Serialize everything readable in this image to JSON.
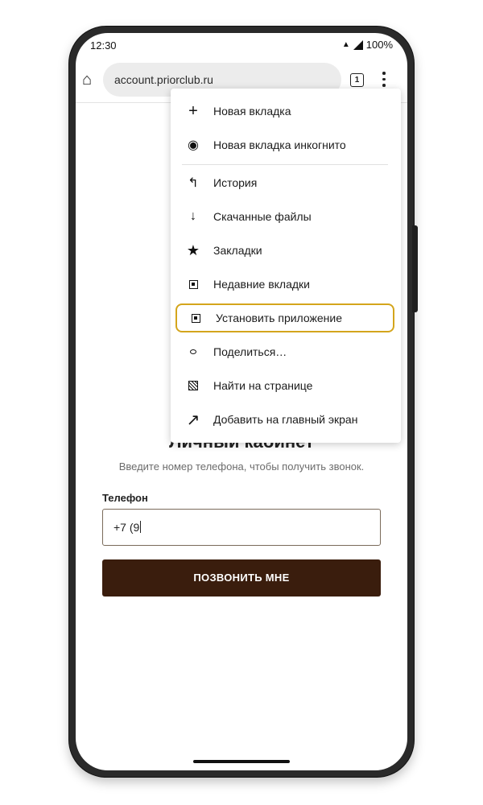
{
  "status_bar": {
    "time": "12:30",
    "battery": "100%"
  },
  "browser": {
    "url": "account.priorclub.ru",
    "tab_count": "1"
  },
  "menu": {
    "items": [
      {
        "label": "Новая вкладка",
        "icon": "plus-icon"
      },
      {
        "label": "Новая вкладка инкогнито",
        "icon": "incognito-icon"
      },
      {
        "label": "История",
        "icon": "history-icon"
      },
      {
        "label": "Скачанные файлы",
        "icon": "download-icon"
      },
      {
        "label": "Закладки",
        "icon": "star-icon"
      },
      {
        "label": "Недавние вкладки",
        "icon": "recent-tabs-icon"
      },
      {
        "label": "Установить приложение",
        "icon": "install-app-icon",
        "highlighted": true
      },
      {
        "label": "Поделиться…",
        "icon": "share-icon"
      },
      {
        "label": "Найти на странице",
        "icon": "find-in-page-icon"
      },
      {
        "label": "Добавить на главный экран",
        "icon": "add-to-home-icon"
      }
    ]
  },
  "page": {
    "title": "Личный кабинет",
    "subtitle": "Введите номер телефона, чтобы получить звонок.",
    "phone_label": "Телефон",
    "phone_value": "+7 (9",
    "call_button": "ПОЗВОНИТЬ МНЕ"
  },
  "colors": {
    "button_bg": "#3a1d0d",
    "highlight": "#d4a51c"
  }
}
